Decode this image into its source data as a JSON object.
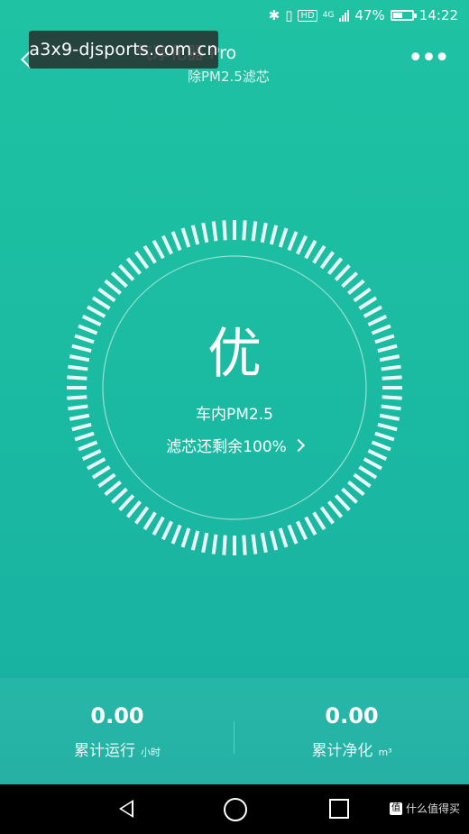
{
  "status_bar": {
    "battery": "47%",
    "time": "14:22",
    "hd": "HD",
    "network": "4G"
  },
  "header": {
    "title": "气净化器 Pro",
    "subtitle": "除PM2.5滤芯"
  },
  "watermark": "a3x9-djsports.com.cn",
  "main": {
    "grade": "优",
    "pm_label": "车内PM2.5",
    "filter_text": "滤芯还剩余100%"
  },
  "stats": {
    "runtime": {
      "value": "0.00",
      "label": "累计运行",
      "unit": "小时"
    },
    "purified": {
      "value": "0.00",
      "label": "累计净化",
      "unit": "m³"
    }
  },
  "footer_brand": "什么值得买",
  "footer_badge": "值",
  "colors": {
    "background": "#1fc2a3",
    "ring": "#ffffff"
  }
}
